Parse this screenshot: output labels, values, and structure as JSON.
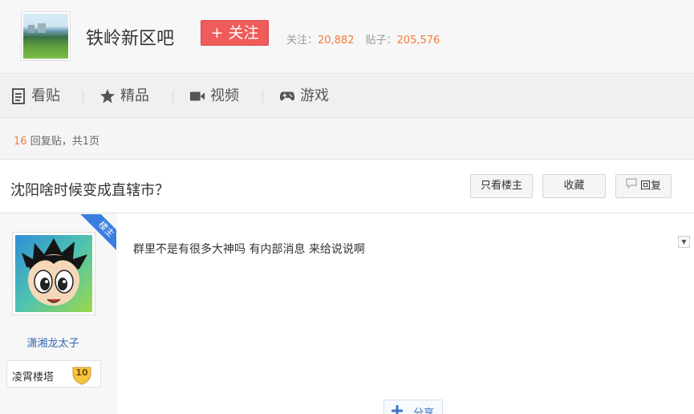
{
  "forum": {
    "name": "铁岭新区吧",
    "follow_label": "+ 关注",
    "follow_count_label": "关注：",
    "follow_count": "20,882",
    "post_count_label": "贴子：",
    "post_count": "205,576"
  },
  "nav": {
    "tabs": [
      {
        "label": "看贴",
        "icon": "document-icon"
      },
      {
        "label": "精品",
        "icon": "star-icon"
      },
      {
        "label": "视频",
        "icon": "video-camera-icon"
      },
      {
        "label": "游戏",
        "icon": "gamepad-icon"
      }
    ]
  },
  "reply_info": {
    "count": "16",
    "text": "回复贴，共1页"
  },
  "thread": {
    "title": "沈阳啥时候变成直辖市？",
    "only_op_label": "只看楼主",
    "favorite_label": "收藏",
    "reply_label": "回复"
  },
  "post": {
    "op_badge": "楼主",
    "author": "潇湘龙太子",
    "level_name": "凌霄楼塔",
    "level": "10",
    "content": "群里不是有很多大神吗 有内部消息 来给说说啊",
    "share_label": "分享"
  },
  "colors": {
    "accent_red": "#f05b5b",
    "number_orange": "#f27b3d",
    "link_blue": "#3166b4",
    "ribbon_blue": "#3a7fe0"
  }
}
